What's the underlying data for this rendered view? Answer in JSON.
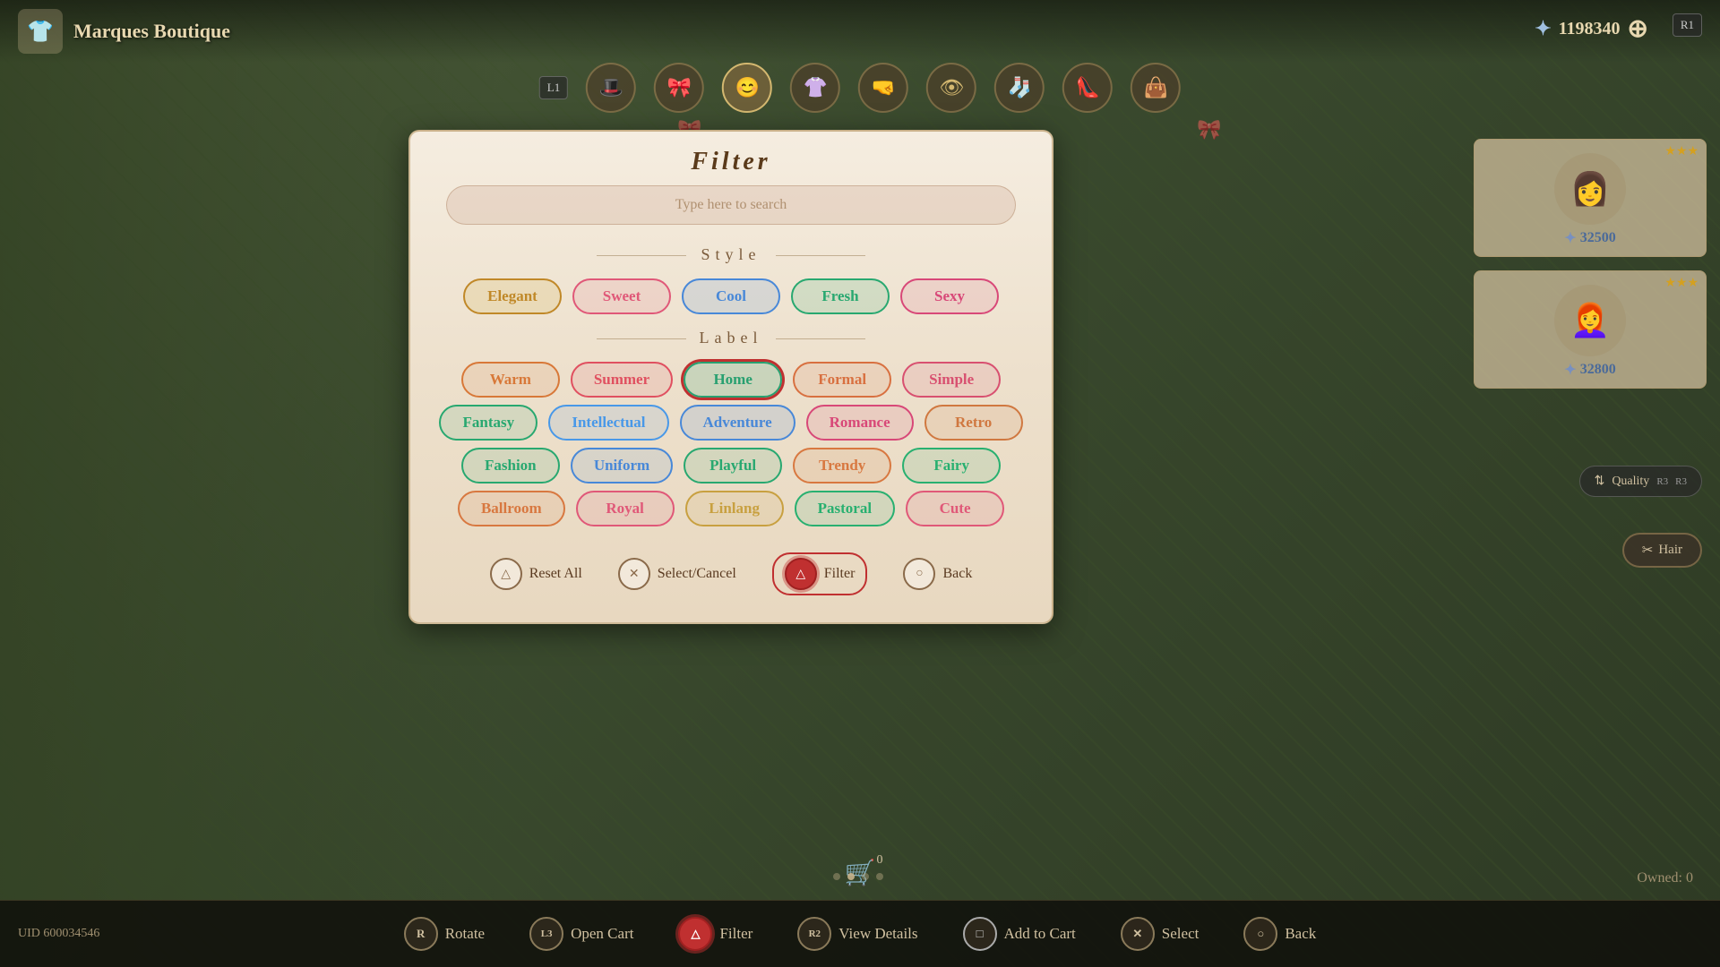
{
  "shop": {
    "name": "Marques Boutique",
    "icon": "👕",
    "currency_icon": "✦",
    "currency_amount": "1198340"
  },
  "nav": {
    "l1": "L1",
    "r1": "R1",
    "icons": [
      "😊",
      "🎀",
      "👒",
      "👚",
      "🤜",
      "👁️",
      "🧦",
      "👠",
      "👜"
    ]
  },
  "filter": {
    "title": "Filter",
    "search_placeholder": "Type here to search",
    "sections": {
      "style": {
        "label": "Style",
        "tags": [
          {
            "id": "elegant",
            "label": "Elegant",
            "class": "tag-elegant"
          },
          {
            "id": "sweet",
            "label": "Sweet",
            "class": "tag-sweet"
          },
          {
            "id": "cool",
            "label": "Cool",
            "class": "tag-cool"
          },
          {
            "id": "fresh",
            "label": "Fresh",
            "class": "tag-fresh"
          },
          {
            "id": "sexy",
            "label": "Sexy",
            "class": "tag-sexy"
          }
        ]
      },
      "label": {
        "label": "Label",
        "rows": [
          [
            {
              "id": "warm",
              "label": "Warm",
              "class": "tag-warm"
            },
            {
              "id": "summer",
              "label": "Summer",
              "class": "tag-summer"
            },
            {
              "id": "home",
              "label": "Home",
              "class": "tag-home",
              "active": true
            },
            {
              "id": "formal",
              "label": "Formal",
              "class": "tag-formal"
            },
            {
              "id": "simple",
              "label": "Simple",
              "class": "tag-simple"
            }
          ],
          [
            {
              "id": "fantasy",
              "label": "Fantasy",
              "class": "tag-fantasy"
            },
            {
              "id": "intellectual",
              "label": "Intellectual",
              "class": "tag-intellectual"
            },
            {
              "id": "adventure",
              "label": "Adventure",
              "class": "tag-adventure"
            },
            {
              "id": "romance",
              "label": "Romance",
              "class": "tag-romance"
            },
            {
              "id": "retro",
              "label": "Retro",
              "class": "tag-retro"
            }
          ],
          [
            {
              "id": "fashion",
              "label": "Fashion",
              "class": "tag-fashion"
            },
            {
              "id": "uniform",
              "label": "Uniform",
              "class": "tag-uniform"
            },
            {
              "id": "playful",
              "label": "Playful",
              "class": "tag-playful"
            },
            {
              "id": "trendy",
              "label": "Trendy",
              "class": "tag-trendy"
            },
            {
              "id": "fairy",
              "label": "Fairy",
              "class": "tag-fairy"
            }
          ],
          [
            {
              "id": "ballroom",
              "label": "Ballroom",
              "class": "tag-ballroom"
            },
            {
              "id": "royal",
              "label": "Royal",
              "class": "tag-royal"
            },
            {
              "id": "linlang",
              "label": "Linlang",
              "class": "tag-linlang"
            },
            {
              "id": "pastoral",
              "label": "Pastoral",
              "class": "tag-pastoral"
            },
            {
              "id": "cute",
              "label": "Cute",
              "class": "tag-cute"
            }
          ]
        ]
      }
    },
    "controls": [
      {
        "id": "reset",
        "icon": "△",
        "label": "Reset All"
      },
      {
        "id": "select_cancel",
        "icon": "✕",
        "label": "Select/Cancel"
      },
      {
        "id": "filter",
        "icon": "△",
        "label": "Filter"
      },
      {
        "id": "back",
        "icon": "○",
        "label": "Back"
      }
    ]
  },
  "right_panel": {
    "items": [
      {
        "stars": "★★★",
        "price": "32500",
        "icon": "👩"
      },
      {
        "stars": "★★★",
        "price": "32800",
        "icon": "👩‍🦰"
      }
    ],
    "quality_label": "Quality",
    "hair_label": "Hair"
  },
  "bottom": {
    "cart_count": "0",
    "owned": "Owned: 0",
    "buttons": [
      {
        "id": "rotate",
        "prefix": "R",
        "label": "Rotate"
      },
      {
        "id": "open_cart",
        "prefix": "L3",
        "label": "Open Cart"
      },
      {
        "id": "filter",
        "prefix": "△",
        "label": "Filter"
      },
      {
        "id": "view_details",
        "prefix": "R2",
        "label": "View Details"
      },
      {
        "id": "add_to_cart",
        "prefix": "□",
        "label": "Add to Cart"
      },
      {
        "id": "select",
        "prefix": "✕",
        "label": "Select"
      },
      {
        "id": "back_btn",
        "prefix": "○",
        "label": "Back"
      }
    ],
    "uid": "UID 600034546"
  }
}
